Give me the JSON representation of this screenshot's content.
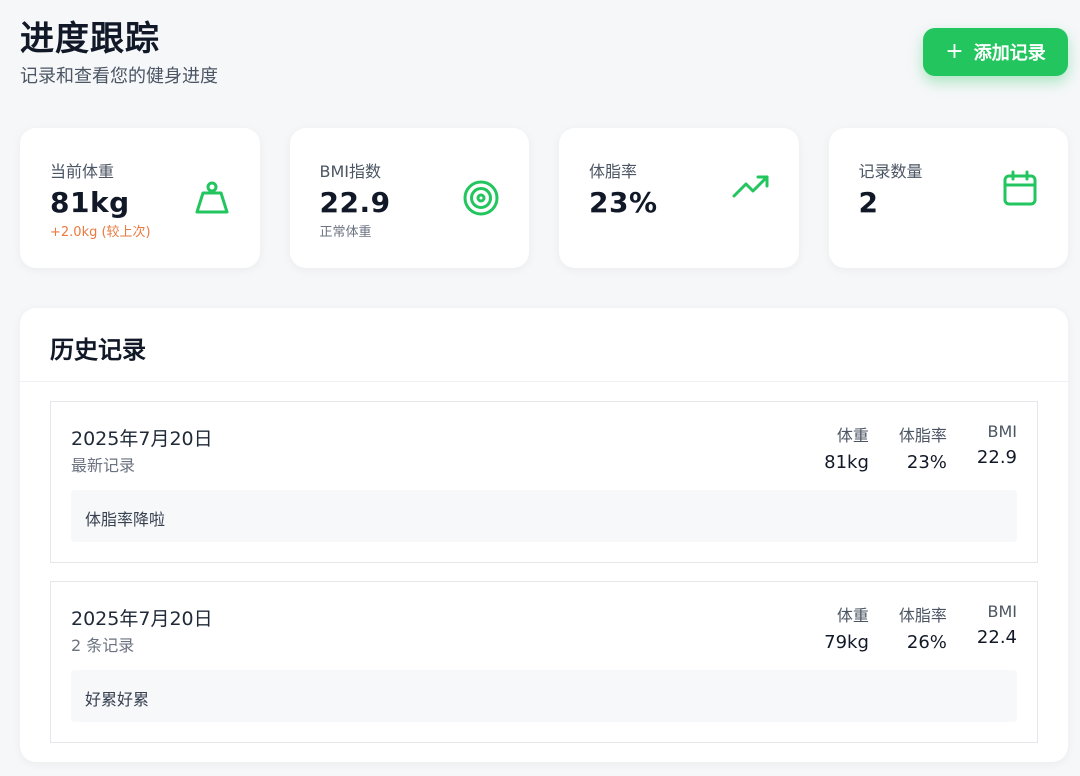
{
  "header": {
    "title": "进度跟踪",
    "subtitle": "记录和查看您的健身进度",
    "add_button": "添加记录"
  },
  "stats": [
    {
      "label": "当前体重",
      "value": "81kg",
      "sub": "+2.0kg (较上次)",
      "icon": "weight-icon"
    },
    {
      "label": "BMI指数",
      "value": "22.9",
      "sub": "正常体重",
      "icon": "target-icon"
    },
    {
      "label": "体脂率",
      "value": "23%",
      "sub": "",
      "icon": "trending-up-icon"
    },
    {
      "label": "记录数量",
      "value": "2",
      "sub": "",
      "icon": "calendar-icon"
    }
  ],
  "history": {
    "title": "历史记录",
    "records": [
      {
        "date": "2025年7月20日",
        "tag": "最新记录",
        "metrics": [
          {
            "label": "体重",
            "value": "81kg"
          },
          {
            "label": "体脂率",
            "value": "23%"
          },
          {
            "label": "BMI",
            "value": "22.9"
          }
        ],
        "note": "体脂率降啦"
      },
      {
        "date": "2025年7月20日",
        "tag": "2 条记录",
        "metrics": [
          {
            "label": "体重",
            "value": "79kg"
          },
          {
            "label": "体脂率",
            "value": "26%"
          },
          {
            "label": "BMI",
            "value": "22.4"
          }
        ],
        "note": "好累好累"
      }
    ]
  },
  "colors": {
    "accent": "#22c55e",
    "warning": "#ea7a3f"
  }
}
